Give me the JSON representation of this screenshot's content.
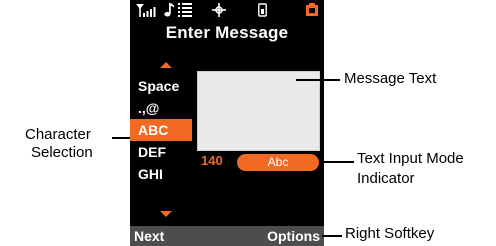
{
  "screen": {
    "title": "Enter Message",
    "character_options": [
      "Space",
      ".,@",
      "ABC",
      "DEF",
      "GHI"
    ],
    "selected_character_option": "ABC",
    "character_count": "140",
    "input_mode": "Abc",
    "softkeys": {
      "left": "Next",
      "right": "Options"
    },
    "status_icons": [
      "signal-strength-icon",
      "music-note-icon",
      "message-icon",
      "location-icon",
      "lock-icon",
      "battery-icon"
    ]
  },
  "callouts": {
    "message_text": "Message Text",
    "character_selection": [
      "Character",
      "Selection"
    ],
    "text_input_mode": [
      "Text Input Mode",
      "Indicator"
    ],
    "right_softkey": "Right Softkey"
  },
  "colors": {
    "accent": "#f26a21",
    "screen_bg": "#000000",
    "softbar": "#4d4d4d",
    "text_area": "#e9e9e9"
  }
}
